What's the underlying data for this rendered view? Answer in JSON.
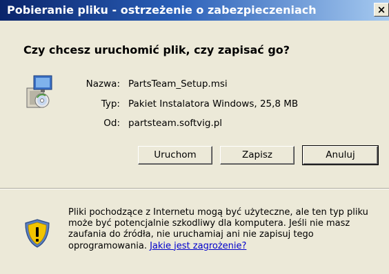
{
  "window": {
    "title": "Pobieranie pliku - ostrzeżenie o zabezpieczeniach",
    "close_label": "×"
  },
  "dialog": {
    "question": "Czy chcesz uruchomić plik, czy zapisać go?",
    "fields": [
      {
        "label": "Nazwa:",
        "value": "PartsTeam_Setup.msi"
      },
      {
        "label": "Typ:",
        "value": "Pakiet Instalatora Windows, 25,8 MB"
      },
      {
        "label": "Od:",
        "value": "partsteam.softvig.pl"
      }
    ],
    "buttons": {
      "run": "Uruchom",
      "save": "Zapisz",
      "cancel": "Anuluj"
    }
  },
  "warning": {
    "line1": "Pliki pochodzące z Internetu mogą być użyteczne, ale ten typ pliku",
    "line2": "może być potencjalnie szkodliwy dla komputera. Jeśli nie masz",
    "line3": "zaufania do źródła, nie uruchamiaj ani nie zapisuj tego",
    "line4_prefix": "oprogramowania.",
    "link": "Jakie jest zagrożenie?"
  },
  "icons": {
    "file": "installer-package-icon",
    "warning": "security-shield-icon"
  },
  "colors": {
    "title_bar_start": "#0a246a",
    "title_bar_end": "#a6caf0",
    "dialog_bg": "#ece9d8",
    "link": "#0000cc",
    "shield_yellow": "#f2c400"
  }
}
